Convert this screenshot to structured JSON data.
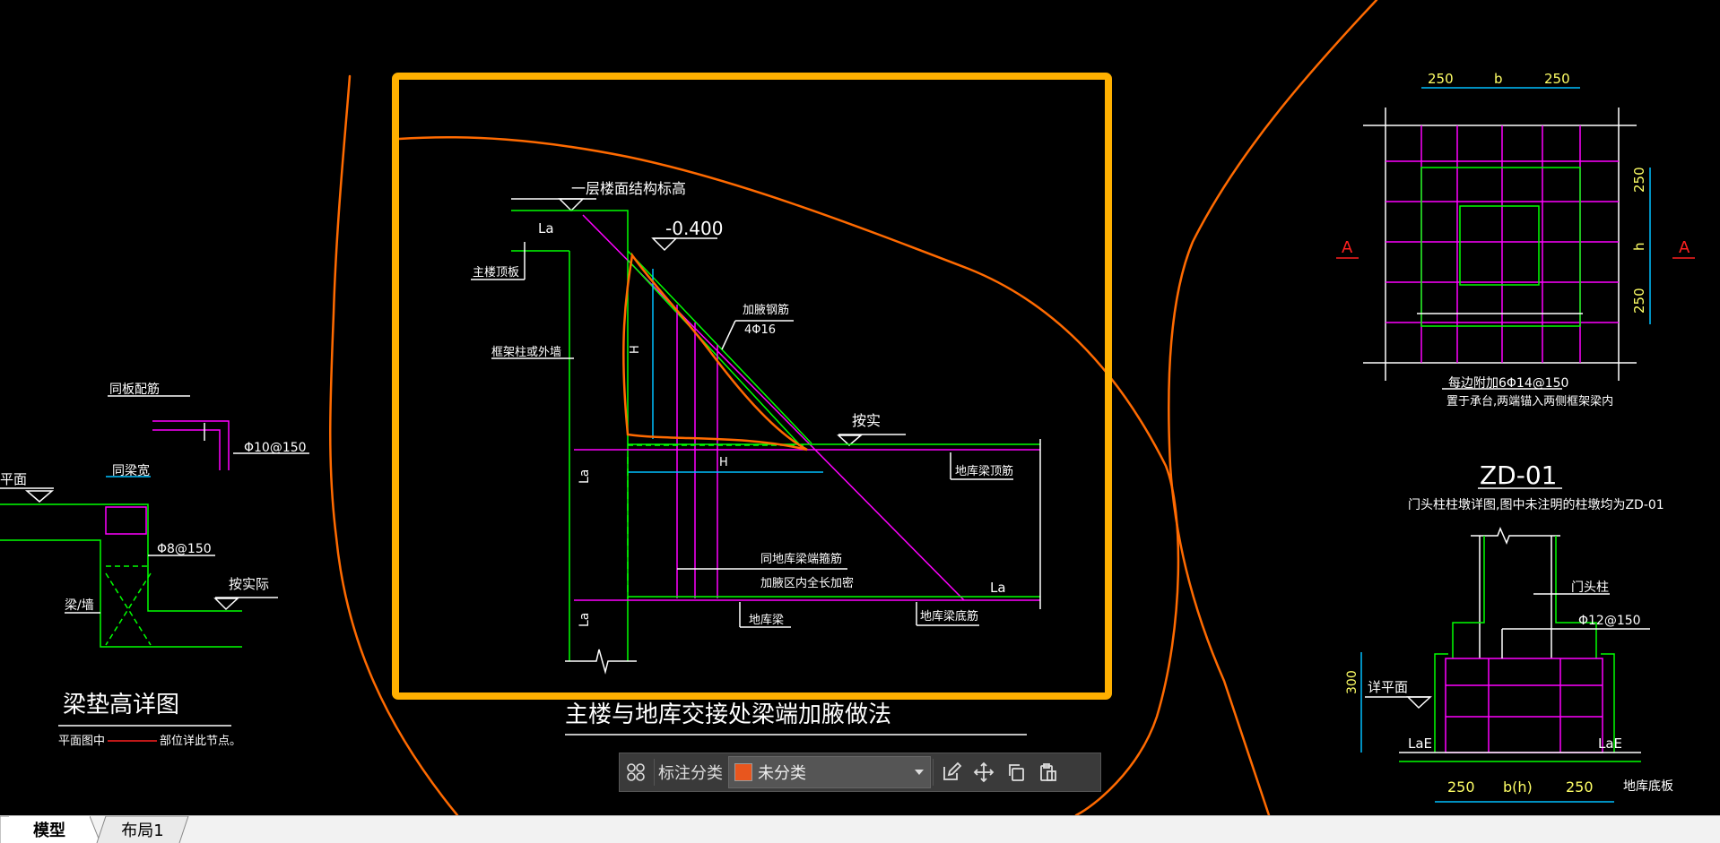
{
  "drawing": {
    "left_detail": {
      "title": "梁垫高详图",
      "note_prefix": "平面图中",
      "note_suffix": "部位详此节点。",
      "labels": [
        "同板配筋",
        "Φ10@150",
        "平面",
        "同梁宽",
        "Φ8@150",
        "梁/墙",
        "按实际"
      ]
    },
    "center_detail": {
      "title": "主楼与地库交接处梁端加腋做法",
      "labels": [
        "一层楼面结构标高",
        "-0.400",
        "La",
        "主楼顶板",
        "框架柱或外墙",
        "加腋钢筋",
        "4Φ16",
        "H",
        "按实",
        "地库梁顶筋",
        "H",
        "La",
        "同地库梁端箍筋",
        "加腋区内全长加密",
        "地库梁",
        "La",
        "地库梁底筋",
        "La"
      ]
    },
    "right_top_detail": {
      "labels": [
        "250",
        "b",
        "250",
        "250",
        "h",
        "250",
        "A",
        "A",
        "每边附加6Φ14@150",
        "置于承台,两端锚入两侧框架梁内"
      ]
    },
    "right_bottom_detail": {
      "title": "ZD-01",
      "subtitle": "门头柱柱墩详图,图中未注明的柱墩均为ZD-01",
      "labels": [
        "门头柱",
        "Φ12@150",
        "300",
        "详平面",
        "LaE",
        "LaE",
        "250",
        "b(h)",
        "250",
        "地库底板"
      ]
    }
  },
  "toolbar": {
    "label": "标注分类",
    "select_value": "未分类",
    "select_color": "#e8561e",
    "icons": [
      "grid-icon",
      "edit-icon",
      "move-icon",
      "copy-icon",
      "paste-icon"
    ]
  },
  "tabs": [
    {
      "label": "模型",
      "active": true
    },
    {
      "label": "布局1",
      "active": false
    }
  ],
  "colors": {
    "highlight_frame": "#ffb000",
    "markup": "#ff6a00",
    "cad_green": "#00ff00",
    "cad_magenta": "#ff00ff",
    "cad_cyan": "#00bfff",
    "cad_white": "#ffffff",
    "cad_yellow": "#ffff66",
    "cad_red": "#ff2020"
  }
}
